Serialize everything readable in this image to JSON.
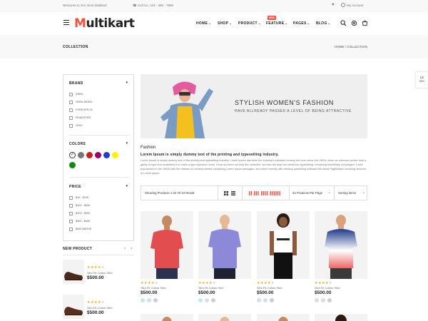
{
  "topbar": {
    "welcome": "Welcome to Our store Multikart",
    "phone": "Call Us: 123 - 456 - 7890",
    "account": "My Account"
  },
  "header": {
    "logo_m": "M",
    "logo_rest": "ultikart",
    "new_badge": "NEW",
    "nav": [
      "HOME",
      "SHOP",
      "PRODUCT",
      "FEATURE",
      "PAGES",
      "BLOG"
    ]
  },
  "breadcrumb": {
    "title": "COLLECTION",
    "path": "HOME  /  COLLECTION"
  },
  "demo_tab": {
    "line1": "DE",
    "line2": "MO"
  },
  "filters": {
    "brand_title": "BRAND",
    "brands": [
      "ZARA",
      "VERA-MODA",
      "FOREVER-21",
      "ROADSTER",
      "ONLY"
    ],
    "colors_title": "COLORS",
    "colors": [
      "#ffffff",
      "#777777",
      "#cc1f1f",
      "#a0006b",
      "#1f3ccc",
      "#fff200",
      "#118811"
    ],
    "price_title": "PRICE",
    "prices": [
      "$10 - $100",
      "$100 - $200",
      "$200 - $300",
      "$300 - $400",
      "$400 ABOVE"
    ]
  },
  "new_product": {
    "title": "NEW PRODUCT",
    "items": [
      {
        "name": "Slim Fit Cotton Shirt",
        "price": "$500.00",
        "rating": 4
      },
      {
        "name": "Slim Fit Cotton Shirt",
        "price": "$500.00",
        "rating": 4
      }
    ]
  },
  "banner": {
    "title": "STYLISH WOMEN'S FASHION",
    "subtitle": "HAVE ALLREADY PASSED A LEVEL OF BEING ATTRACTIVE"
  },
  "category": {
    "name": "Fashion",
    "heading": "Lorem Ipsum is simply dummy text of the printing and typesetting industry.",
    "description": "Lorem Ipsum is simply dummy text of the printing and typesetting industry. Lorem Ipsum has been the industry's standard dummy text ever since the 1500s, when an unknown printer took a galley of type and scrambled it to make a type specimen book. It has survived not only five centuries, but also the leap into electronic typesetting, remaining essentially unchanged. It was popularised in the 1960s with the release of Letraset sheets containing Lorem Ipsum passages, and more recently with desktop publishing software like Aldus PageMaker including versions of Lorem Ipsum."
  },
  "toolbar": {
    "showing": "Showing Products 1-24 Of 10 Result",
    "per_page": "24 Products Par Page",
    "sort": "Sorting items"
  },
  "products": [
    {
      "name": "Slim Fit Cotton Shirt",
      "price": "$500.00",
      "rating": 4,
      "swatches": [
        "#c8e4f0",
        "#cfe0f5",
        "#cfcfcf"
      ]
    },
    {
      "name": "Slim Fit Cotton Shirt",
      "price": "$500.00",
      "rating": 4,
      "swatches": [
        "#c8e4f0",
        "#cfe0f5",
        "#cfcfcf"
      ]
    },
    {
      "name": "Slim Fit Cotton Shirt",
      "price": "$500.00",
      "rating": 4,
      "swatches": [
        "#c8e4f0",
        "#cfe0f5",
        "#cfcfcf"
      ]
    },
    {
      "name": "Slim Fit Cotton Shirt",
      "price": "$500.00",
      "rating": 4,
      "swatches": [
        "#c8e4f0",
        "#cfe0f5",
        "#cfcfcf"
      ]
    }
  ],
  "colors": {
    "accent": "#ff4c3b",
    "star": "#ffa200"
  }
}
